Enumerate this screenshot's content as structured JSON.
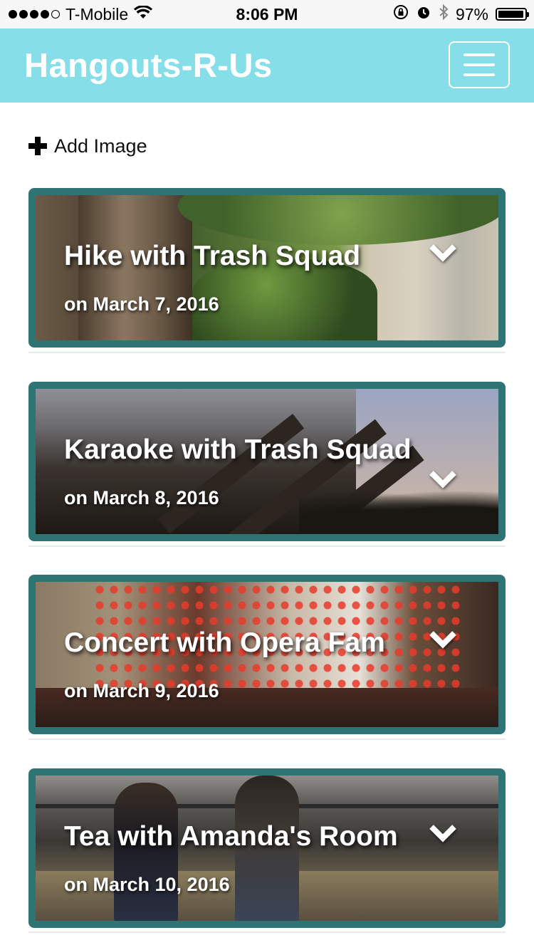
{
  "status_bar": {
    "carrier": "T-Mobile",
    "time": "8:06 PM",
    "battery": "97%",
    "battery_level": 0.97,
    "signal_icons": [
      "signal-dots-icon",
      "wifi-icon",
      "rotation-lock-icon",
      "alarm-icon",
      "bluetooth-icon",
      "battery-icon"
    ]
  },
  "navbar": {
    "brand": "Hangouts-R-Us",
    "menu_icon": "hamburger-menu-icon",
    "bg_color": "#86dfe8"
  },
  "actions": {
    "add_image_label": "Add Image",
    "add_icon": "plus-icon"
  },
  "cards": [
    {
      "title": "Hike with Trash Squad",
      "date": "on March 7, 2016",
      "expand_icon": "chevron-down-icon"
    },
    {
      "title": "Karaoke with Trash Squad",
      "date": "on March 8, 2016",
      "expand_icon": "chevron-down-icon"
    },
    {
      "title": "Concert with Opera Fam",
      "date": "on March 9, 2016",
      "expand_icon": "chevron-down-icon"
    },
    {
      "title": "Tea with Amanda's Room",
      "date": "on March 10, 2016",
      "expand_icon": "chevron-down-icon"
    }
  ],
  "colors": {
    "card_border": "#2f7475",
    "navbar": "#86dfe8"
  }
}
